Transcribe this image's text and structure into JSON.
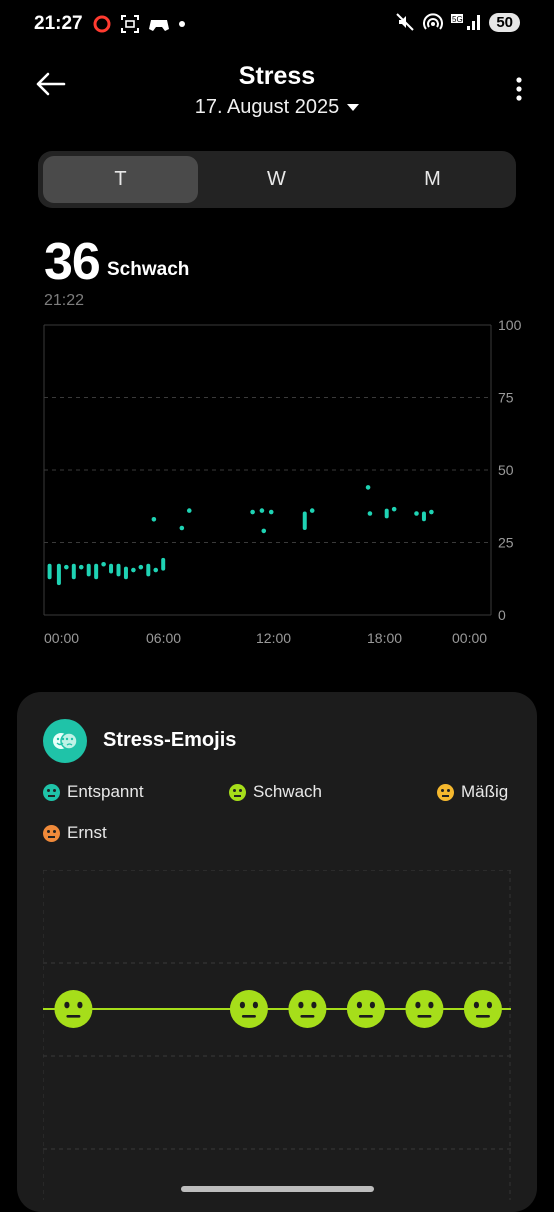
{
  "status_bar": {
    "time": "21:27",
    "battery": "50",
    "left_icons": [
      "opera-icon",
      "screenshot-icon",
      "game-icon",
      "dot-icon"
    ],
    "right_icons": [
      "mute-icon",
      "hotspot-icon",
      "5g-signal-icon",
      "battery-icon"
    ]
  },
  "header": {
    "title": "Stress",
    "date": "17. August 2025"
  },
  "tabs": [
    {
      "label": "T",
      "active": true
    },
    {
      "label": "W",
      "active": false
    },
    {
      "label": "M",
      "active": false
    }
  ],
  "current": {
    "value": "36",
    "level": "Schwach",
    "time": "21:22"
  },
  "chart_data": {
    "type": "scatter",
    "x_labels": [
      "00:00",
      "06:00",
      "12:00",
      "18:00",
      "00:00"
    ],
    "y_ticks": [
      "100",
      "75",
      "50",
      "25",
      "0"
    ],
    "ylim": [
      0,
      100
    ],
    "xlim_hours": [
      0,
      24
    ],
    "accent": "#1fd3b4",
    "points": [
      {
        "h": 0.3,
        "lo": 13,
        "hi": 17
      },
      {
        "h": 0.8,
        "lo": 11,
        "hi": 17
      },
      {
        "h": 1.2,
        "lo": 16,
        "hi": 17
      },
      {
        "h": 1.6,
        "lo": 13,
        "hi": 17
      },
      {
        "h": 2.0,
        "lo": 16,
        "hi": 17
      },
      {
        "h": 2.4,
        "lo": 14,
        "hi": 17
      },
      {
        "h": 2.8,
        "lo": 13,
        "hi": 17
      },
      {
        "h": 3.2,
        "lo": 17,
        "hi": 18
      },
      {
        "h": 3.6,
        "lo": 15,
        "hi": 17
      },
      {
        "h": 4.0,
        "lo": 14,
        "hi": 17
      },
      {
        "h": 4.4,
        "lo": 13,
        "hi": 16
      },
      {
        "h": 4.8,
        "lo": 15,
        "hi": 16
      },
      {
        "h": 5.2,
        "lo": 16,
        "hi": 17
      },
      {
        "h": 5.6,
        "lo": 14,
        "hi": 17
      },
      {
        "h": 6.0,
        "lo": 15,
        "hi": 16
      },
      {
        "h": 6.4,
        "lo": 16,
        "hi": 19
      },
      {
        "h": 5.9,
        "lo": 33,
        "hi": 33
      },
      {
        "h": 7.4,
        "lo": 30,
        "hi": 30
      },
      {
        "h": 7.8,
        "lo": 36,
        "hi": 36
      },
      {
        "h": 11.2,
        "lo": 35,
        "hi": 36
      },
      {
        "h": 11.7,
        "lo": 36,
        "hi": 36
      },
      {
        "h": 11.8,
        "lo": 29,
        "hi": 29
      },
      {
        "h": 12.2,
        "lo": 35,
        "hi": 36
      },
      {
        "h": 14.0,
        "lo": 30,
        "hi": 35
      },
      {
        "h": 14.4,
        "lo": 36,
        "hi": 36
      },
      {
        "h": 17.4,
        "lo": 44,
        "hi": 44
      },
      {
        "h": 17.5,
        "lo": 35,
        "hi": 35
      },
      {
        "h": 18.4,
        "lo": 34,
        "hi": 36
      },
      {
        "h": 18.8,
        "lo": 36,
        "hi": 37
      },
      {
        "h": 20.0,
        "lo": 35,
        "hi": 35
      },
      {
        "h": 20.4,
        "lo": 33,
        "hi": 35
      },
      {
        "h": 20.8,
        "lo": 35,
        "hi": 36
      }
    ]
  },
  "emoji_card": {
    "title": "Stress-Emojis",
    "legend": [
      {
        "label": "Entspannt",
        "color": "#1fc3a8"
      },
      {
        "label": "Schwach",
        "color": "#a6de1a"
      },
      {
        "label": "Mäßig",
        "color": "#f5b82e"
      },
      {
        "label": "Ernst",
        "color": "#f08a3a"
      }
    ],
    "emoji_color": "#a6de1a",
    "emoji_positions_frac": [
      0.065,
      0.44,
      0.565,
      0.69,
      0.815,
      0.94
    ]
  }
}
